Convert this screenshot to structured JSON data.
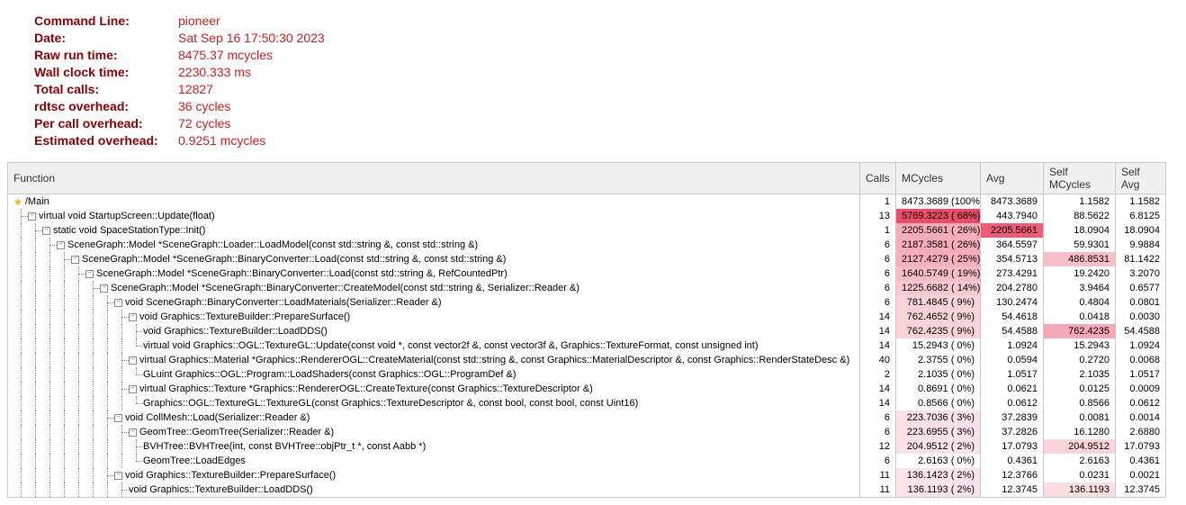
{
  "header": [
    {
      "label": "Command Line:",
      "value": "pioneer"
    },
    {
      "label": "Date:",
      "value": "Sat Sep 16 17:50:30 2023"
    },
    {
      "label": "Raw run time:",
      "value": "8475.37 mcycles"
    },
    {
      "label": "Wall clock time:",
      "value": "2230.333 ms"
    },
    {
      "label": "Total calls:",
      "value": "12827"
    },
    {
      "label": "rdtsc overhead:",
      "value": "36 cycles"
    },
    {
      "label": "Per call overhead:",
      "value": "72 cycles"
    },
    {
      "label": "Estimated overhead:",
      "value": "0.9251 mcycles"
    }
  ],
  "columns": {
    "function": "Function",
    "calls": "Calls",
    "mcycles": "MCycles",
    "avg": "Avg",
    "self_mcycles": "Self MCycles",
    "self_avg": "Self Avg"
  },
  "rows": [
    {
      "depth": 0,
      "star": true,
      "toggle": false,
      "name": "/Main",
      "calls": "1",
      "mcy": "8473.3689 (100%)",
      "avg": "8473.3689",
      "self": "1.1582",
      "savg": "1.1582",
      "heat_mcy": 0,
      "heat_self": 0
    },
    {
      "depth": 1,
      "toggle": true,
      "name": "virtual void StartupScreen::Update(float)",
      "calls": "13",
      "mcy": "5769.3223 ( 68%)",
      "avg": "443.7940",
      "self": "88.5622",
      "savg": "6.8125",
      "heat_mcy": 0.68,
      "heat_self": 0
    },
    {
      "depth": 2,
      "toggle": true,
      "name": "static void SpaceStationType::Init()",
      "calls": "1",
      "mcy": "2205.5661 ( 26%)",
      "avg": "2205.5661",
      "self": "18.0904",
      "savg": "18.0904",
      "heat_mcy": 0.26,
      "heat_avg": 0.6,
      "heat_self": 0
    },
    {
      "depth": 3,
      "toggle": true,
      "name": "SceneGraph::Model *SceneGraph::Loader::LoadModel(const std::string &, const std::string &)",
      "calls": "6",
      "mcy": "2187.3581 ( 26%)",
      "avg": "364.5597",
      "self": "59.9301",
      "savg": "9.9884",
      "heat_mcy": 0.26,
      "heat_self": 0
    },
    {
      "depth": 4,
      "toggle": true,
      "name": "SceneGraph::Model *SceneGraph::BinaryConverter::Load(const std::string &, const std::string &)",
      "calls": "6",
      "mcy": "2127.4279 ( 25%)",
      "avg": "354.5713",
      "self": "486.8531",
      "savg": "81.1422",
      "heat_mcy": 0.25,
      "heat_self": 0.18
    },
    {
      "depth": 5,
      "toggle": true,
      "name": "SceneGraph::Model *SceneGraph::BinaryConverter::Load(const std::string &, RefCountedPtr)",
      "calls": "6",
      "mcy": "1640.5749 ( 19%)",
      "avg": "273.4291",
      "self": "19.2420",
      "savg": "3.2070",
      "heat_mcy": 0.19,
      "heat_self": 0
    },
    {
      "depth": 6,
      "toggle": true,
      "name": "SceneGraph::Model *SceneGraph::BinaryConverter::CreateModel(const std::string &, Serializer::Reader &)",
      "calls": "6",
      "mcy": "1225.6682 ( 14%)",
      "avg": "204.2780",
      "self": "3.9464",
      "savg": "0.6577",
      "heat_mcy": 0.14,
      "heat_self": 0
    },
    {
      "depth": 7,
      "toggle": true,
      "name": "void SceneGraph::BinaryConverter::LoadMaterials(Serializer::Reader &)",
      "calls": "6",
      "mcy": "781.4845 (  9%)",
      "avg": "130.2474",
      "self": "0.4804",
      "savg": "0.0801",
      "heat_mcy": 0.09,
      "heat_self": 0
    },
    {
      "depth": 8,
      "toggle": true,
      "name": "void Graphics::TextureBuilder::PrepareSurface()",
      "calls": "14",
      "mcy": "762.4652 (  9%)",
      "avg": "54.4618",
      "self": "0.0418",
      "savg": "0.0030",
      "heat_mcy": 0.09,
      "heat_self": 0
    },
    {
      "depth": 9,
      "toggle": false,
      "last": false,
      "name": "void Graphics::TextureBuilder::LoadDDS()",
      "calls": "14",
      "mcy": "762.4235 (  9%)",
      "avg": "54.4588",
      "self": "762.4235",
      "savg": "54.4588",
      "heat_mcy": 0.09,
      "heat_self": 0.28
    },
    {
      "depth": 9,
      "toggle": false,
      "last": true,
      "name": "virtual void Graphics::OGL::TextureGL::Update(const void *, const vector2f &, const vector3f &, Graphics::TextureFormat, const unsigned int)",
      "calls": "14",
      "mcy": "15.2943 (  0%)",
      "avg": "1.0924",
      "self": "15.2943",
      "savg": "1.0924",
      "heat_mcy": 0,
      "heat_self": 0
    },
    {
      "depth": 8,
      "toggle": true,
      "name": "virtual Graphics::Material *Graphics::RendererOGL::CreateMaterial(const std::string &, const Graphics::MaterialDescriptor &, const Graphics::RenderStateDesc &)",
      "calls": "40",
      "mcy": "2.3755 (  0%)",
      "avg": "0.0594",
      "self": "0.2720",
      "savg": "0.0068",
      "heat_mcy": 0,
      "heat_self": 0
    },
    {
      "depth": 9,
      "toggle": false,
      "last": true,
      "name": "GLuint Graphics::OGL::Program::LoadShaders(const Graphics::OGL::ProgramDef &)",
      "calls": "2",
      "mcy": "2.1035 (  0%)",
      "avg": "1.0517",
      "self": "2.1035",
      "savg": "1.0517",
      "heat_mcy": 0,
      "heat_self": 0
    },
    {
      "depth": 8,
      "toggle": true,
      "name": "virtual Graphics::Texture *Graphics::RendererOGL::CreateTexture(const Graphics::TextureDescriptor &)",
      "calls": "14",
      "mcy": "0.8691 (  0%)",
      "avg": "0.0621",
      "self": "0.0125",
      "savg": "0.0009",
      "heat_mcy": 0,
      "heat_self": 0
    },
    {
      "depth": 9,
      "toggle": false,
      "last": true,
      "name": "Graphics::OGL::TextureGL::TextureGL(const Graphics::TextureDescriptor &, const bool, const bool, const Uint16)",
      "calls": "14",
      "mcy": "0.8566 (  0%)",
      "avg": "0.0612",
      "self": "0.8566",
      "savg": "0.0612",
      "heat_mcy": 0,
      "heat_self": 0
    },
    {
      "depth": 7,
      "toggle": true,
      "name": "void CollMesh::Load(Serializer::Reader &)",
      "calls": "6",
      "mcy": "223.7036 (  3%)",
      "avg": "37.2839",
      "self": "0.0081",
      "savg": "0.0014",
      "heat_mcy": 0.03,
      "heat_self": 0
    },
    {
      "depth": 8,
      "toggle": true,
      "name": "GeomTree::GeomTree(Serializer::Reader &)",
      "calls": "6",
      "mcy": "223.6955 (  3%)",
      "avg": "37.2826",
      "self": "16.1280",
      "savg": "2.6880",
      "heat_mcy": 0.03,
      "heat_self": 0
    },
    {
      "depth": 9,
      "toggle": false,
      "last": false,
      "name": "BVHTree::BVHTree(int, const BVHTree::objPtr_t *, const Aabb *)",
      "calls": "12",
      "mcy": "204.9512 (  2%)",
      "avg": "17.0793",
      "self": "204.9512",
      "savg": "17.0793",
      "heat_mcy": 0.02,
      "heat_self": 0.08
    },
    {
      "depth": 9,
      "toggle": false,
      "last": true,
      "name": "GeomTree::LoadEdges",
      "calls": "6",
      "mcy": "2.6163 (  0%)",
      "avg": "0.4361",
      "self": "2.6163",
      "savg": "0.4361",
      "heat_mcy": 0,
      "heat_self": 0
    },
    {
      "depth": 7,
      "toggle": true,
      "name": "void Graphics::TextureBuilder::PrepareSurface()",
      "calls": "11",
      "mcy": "136.1423 (  2%)",
      "avg": "12.3766",
      "self": "0.0231",
      "savg": "0.0021",
      "heat_mcy": 0.02,
      "heat_self": 0
    },
    {
      "depth": 8,
      "toggle": false,
      "last": false,
      "name": "void Graphics::TextureBuilder::LoadDDS()",
      "calls": "11",
      "mcy": "136.1193 (  2%)",
      "avg": "12.3745",
      "self": "136.1193",
      "savg": "12.3745",
      "heat_mcy": 0.02,
      "heat_self": 0.05
    }
  ]
}
